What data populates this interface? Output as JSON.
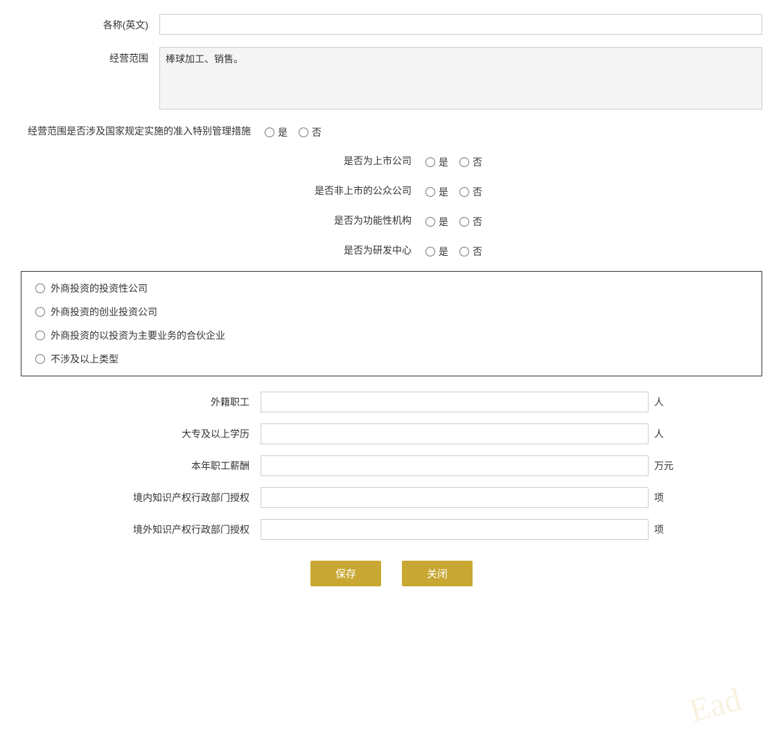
{
  "form": {
    "name_en_label": "各称(英文)",
    "name_en_value": "",
    "name_en_placeholder": "",
    "business_scope_label": "经营范围",
    "business_scope_value": "棒球加工、销售。",
    "special_mgmt_label": "经营范围是否涉及国家规定实施的准入特别管理措施",
    "special_mgmt_yes": "是",
    "special_mgmt_no": "否",
    "listed_company_label": "是否为上市公司",
    "listed_yes": "是",
    "listed_no": "否",
    "non_listed_public_label": "是否非上市的公众公司",
    "non_listed_yes": "是",
    "non_listed_no": "否",
    "functional_institution_label": "是否为功能性机构",
    "functional_yes": "是",
    "functional_no": "否",
    "rd_center_label": "是否为研发中心",
    "rd_yes": "是",
    "rd_no": "否",
    "foreign_invest_types": [
      "外商投资的投资性公司",
      "外商投资的创业投资公司",
      "外商投资的以投资为主要业务的合伙企业",
      "不涉及以上类型"
    ],
    "foreign_workers_label": "外籍职工",
    "foreign_workers_unit": "人",
    "foreign_workers_value": "",
    "college_edu_label": "大专及以上学历",
    "college_edu_unit": "人",
    "college_edu_value": "",
    "annual_salary_label": "本年职工薪酬",
    "annual_salary_unit": "万元",
    "annual_salary_value": "",
    "domestic_ip_label": "境内知识产权行政部门授权",
    "domestic_ip_unit": "项",
    "domestic_ip_value": "",
    "foreign_ip_label": "境外知识产权行政部门授权",
    "foreign_ip_unit": "项",
    "foreign_ip_value": "",
    "save_btn": "保存",
    "close_btn": "关闭",
    "watermark": "Ead"
  }
}
